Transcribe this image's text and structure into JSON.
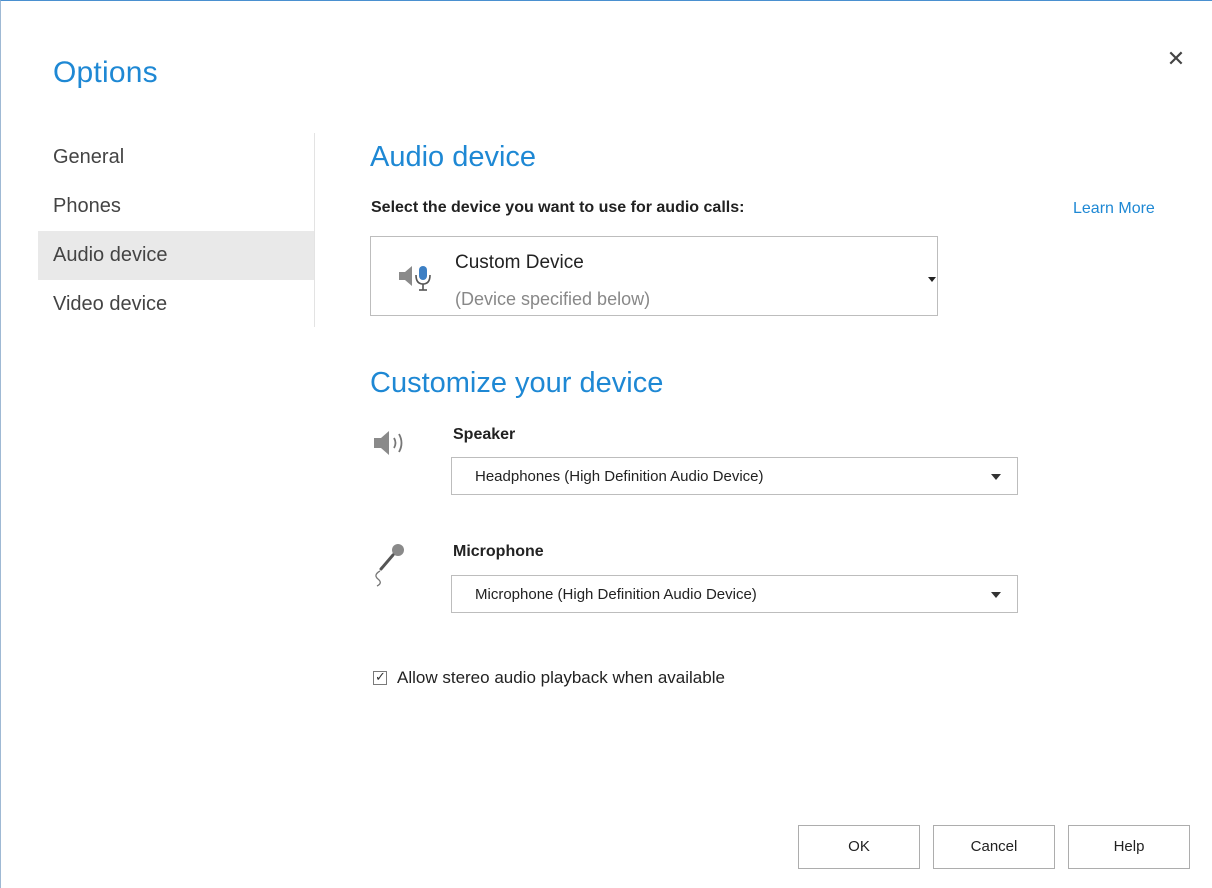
{
  "dialog": {
    "title": "Options",
    "close_icon": "close-icon",
    "close_glyph": "✕"
  },
  "sidebar": {
    "items": [
      {
        "label": "General",
        "active": false
      },
      {
        "label": "Phones",
        "active": false
      },
      {
        "label": "Audio device",
        "active": true
      },
      {
        "label": "Video device",
        "active": false
      }
    ]
  },
  "audio": {
    "section_title": "Audio device",
    "prompt": "Select the device you want to use for audio calls:",
    "learn_more": "Learn More",
    "device": {
      "name": "Custom Device",
      "subtitle": "(Device specified below)",
      "icon": "speaker-microphone-icon"
    }
  },
  "customize": {
    "section_title": "Customize your device",
    "speaker": {
      "label": "Speaker",
      "icon": "speaker-icon",
      "value": "Headphones (High Definition Audio Device)"
    },
    "microphone": {
      "label": "Microphone",
      "icon": "microphone-icon",
      "value": "Microphone (High Definition Audio Device)"
    },
    "stereo_checkbox": {
      "label": "Allow stereo audio playback when available",
      "checked": true
    }
  },
  "buttons": {
    "ok": "OK",
    "cancel": "Cancel",
    "help": "Help"
  },
  "colors": {
    "accent": "#1e88d4",
    "active_nav_bg": "#e9e9e9",
    "mic_icon_blue": "#3d7fc4"
  }
}
